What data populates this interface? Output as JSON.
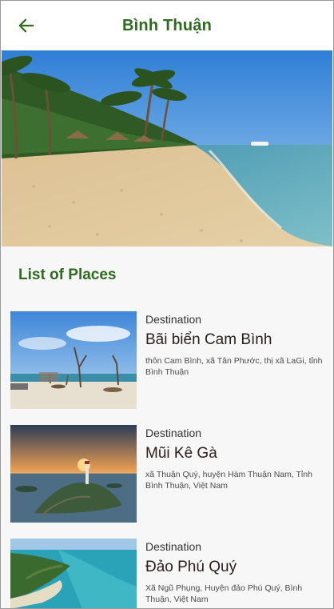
{
  "header": {
    "title": "Bình Thuận",
    "back_icon": "arrow-left-icon",
    "accent_color": "#2e6b1f"
  },
  "section": {
    "title": "List of Places"
  },
  "places": [
    {
      "label": "Destination",
      "name": "Bãi biển Cam Bình",
      "address": "thôn Cam Bình, xã Tân Phước, thị xã LaGi, tỉnh Bình Thuận"
    },
    {
      "label": "Destination",
      "name": "Mũi Kê Gà",
      "address": "xã Thuận Quý, huyện Hàm Thuận Nam, Tỉnh Bình Thuận, Việt Nam"
    },
    {
      "label": "Destination",
      "name": "Đảo Phú Quý",
      "address": "Xã Ngũ Phụng, Huyện đảo Phú Quý, Bình Thuận, Việt Nam"
    }
  ]
}
